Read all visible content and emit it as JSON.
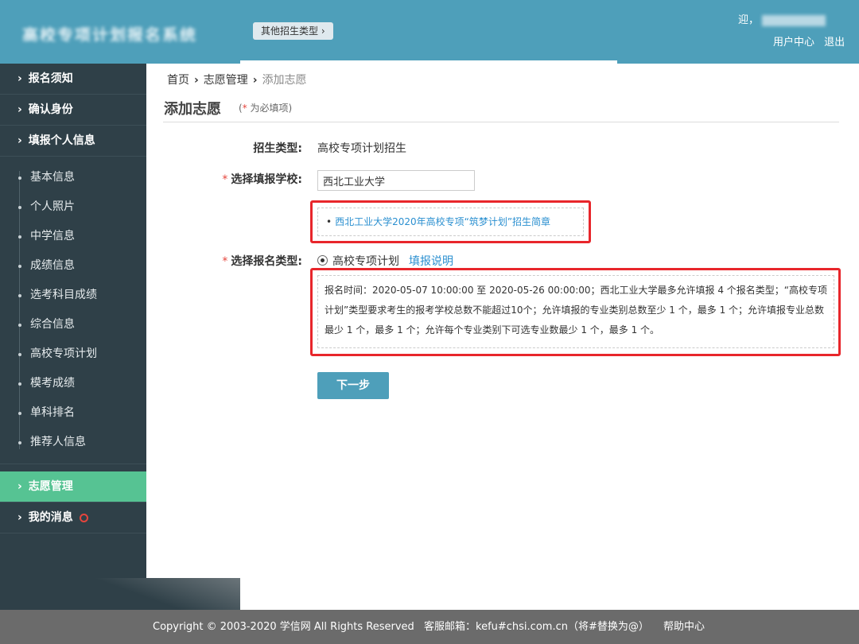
{
  "header": {
    "logo_text": "高校专项计划报名系统",
    "other_types_button": "其他招生类型 ›",
    "welcome": "迎，",
    "user_center": "用户中心",
    "logout": "退出"
  },
  "sidebar": {
    "items": [
      {
        "label": "报名须知"
      },
      {
        "label": "确认身份"
      },
      {
        "label": "填报个人信息"
      }
    ],
    "sub_items": [
      {
        "label": "基本信息"
      },
      {
        "label": "个人照片"
      },
      {
        "label": "中学信息"
      },
      {
        "label": "成绩信息"
      },
      {
        "label": "选考科目成绩"
      },
      {
        "label": "综合信息"
      },
      {
        "label": "高校专项计划"
      },
      {
        "label": "模考成绩"
      },
      {
        "label": "单科排名"
      },
      {
        "label": "推荐人信息"
      }
    ],
    "volunteer": "志愿管理",
    "messages": "我的消息"
  },
  "breadcrumb": {
    "home": "首页",
    "volunteer": "志愿管理",
    "current": "添加志愿"
  },
  "page": {
    "title": "添加志愿",
    "required_prefix": "(",
    "required_star": "*",
    "required_text": " 为必填项)"
  },
  "form": {
    "type_label": "招生类型:",
    "type_value": "高校专项计划招生",
    "school_label": "选择填报学校:",
    "school_value": "西北工业大学",
    "brochure_link": "西北工业大学2020年高校专项“筑梦计划”招生简章",
    "category_label": "选择报名类型:",
    "category_option": "高校专项计划",
    "fill_instructions": "填报说明",
    "info_text": "报名时间：2020-05-07 10:00:00 至 2020-05-26 00:00:00；西北工业大学最多允许填报 4 个报名类型；“高校专项计划”类型要求考生的报考学校总数不能超过10个；允许填报的专业类别总数至少 1 个，最多 1 个；允许填报专业总数最少 1 个，最多 1 个；允许每个专业类别下可选专业数最少 1 个，最多 1 个。",
    "next_button": "下一步"
  },
  "footer": {
    "copyright": "Copyright © 2003-2020 学信网 All Rights Reserved",
    "email": "客服邮箱：kefu#chsi.com.cn（将#替换为@）",
    "help": "帮助中心"
  },
  "colors": {
    "header": "#4e9fba",
    "sidebar": "#2f4048",
    "active": "#56c393",
    "highlight_border": "#e8262b",
    "link": "#2a8fd0"
  }
}
